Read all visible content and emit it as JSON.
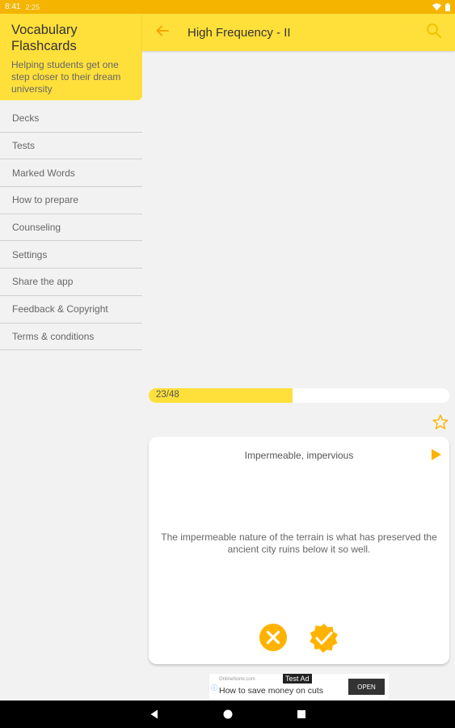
{
  "status_bar": {
    "time": "8:41",
    "notification_text": "2:25",
    "icons": [
      "wifi-icon",
      "battery-icon"
    ]
  },
  "drawer": {
    "title": "Vocabulary Flashcards",
    "subtitle": "Helping students get one step closer to their dream university",
    "items": [
      {
        "label": "Decks"
      },
      {
        "label": "Tests"
      },
      {
        "label": "Marked Words"
      },
      {
        "label": "How to prepare"
      },
      {
        "label": "Counseling"
      },
      {
        "label": "Settings"
      },
      {
        "label": "Share the app"
      },
      {
        "label": "Feedback & Copyright"
      },
      {
        "label": "Terms & conditions"
      }
    ]
  },
  "app_bar": {
    "title": "High Frequency - II",
    "back_icon": "arrow-left-icon",
    "search_icon": "search-icon"
  },
  "progress": {
    "current": 23,
    "total": 48,
    "label": "23/48"
  },
  "card": {
    "word": "Impermeable, impervious",
    "sentence": "The impermeable nature of the terrain is what has preserved the ancient city ruins below it so well.",
    "icons": [
      "star-outline-icon",
      "play-icon",
      "close-circle-icon",
      "check-badge-icon"
    ]
  },
  "ad": {
    "tag": "Test Ad",
    "site": "OnlineNone.com",
    "text": "How to save money on cuts",
    "button": "OPEN"
  },
  "colors": {
    "accent_yellow": "#FFE03B",
    "status_bar": "#F4B400",
    "icon_orange": "#FFB300",
    "back_arrow": "#F4A000"
  }
}
